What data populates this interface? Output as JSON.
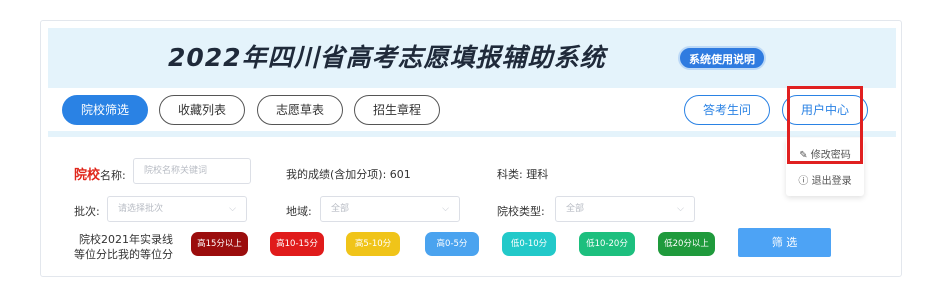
{
  "header": {
    "title": "2022年四川省高考志愿填报辅助系统",
    "help_button": "系统使用说明"
  },
  "nav": {
    "tabs": [
      {
        "label": "院校筛选",
        "active": true
      },
      {
        "label": "收藏列表",
        "active": false
      },
      {
        "label": "志愿草表",
        "active": false
      },
      {
        "label": "招生章程",
        "active": false
      }
    ],
    "ask_button": "答考生问",
    "user_center": "用户中心"
  },
  "user_menu": {
    "items": [
      {
        "icon": "pencil-icon",
        "glyph": "✎",
        "label": "修改密码"
      },
      {
        "icon": "info-circle-icon",
        "glyph": "ⓘ",
        "label": "退出登录"
      }
    ]
  },
  "filters": {
    "school_label_strong": "院校",
    "school_label_rest": "名称:",
    "school_placeholder": "院校名称关键词",
    "score_text": "我的成绩(含加分项): 601",
    "subject_text": "科类: 理科",
    "batch_label": "批次:",
    "batch_placeholder": "请选择批次",
    "region_label": "地域:",
    "region_value": "全部",
    "type_label": "院校类型:",
    "type_value": "全部",
    "rank_label_line1": "院校2021年实录线",
    "rank_label_line2": "等位分比我的等位分",
    "ranges": [
      {
        "label": "高15分以上",
        "color": "#9b0d0d"
      },
      {
        "label": "高10-15分",
        "color": "#e01b1b"
      },
      {
        "label": "高5-10分",
        "color": "#f0c419"
      },
      {
        "label": "高0-5分",
        "color": "#4aa3ef"
      },
      {
        "label": "低0-10分",
        "color": "#22c9c9"
      },
      {
        "label": "低10-20分",
        "color": "#1dbf7e"
      },
      {
        "label": "低20分以上",
        "color": "#1f9a3c"
      }
    ],
    "filter_button": "筛 选"
  }
}
